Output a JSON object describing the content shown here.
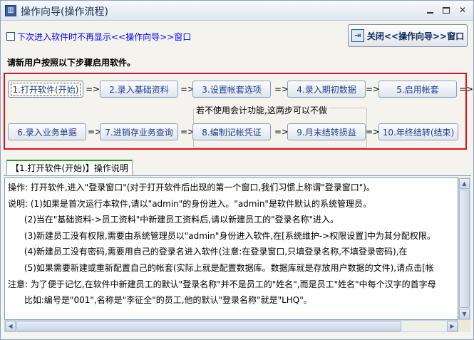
{
  "window": {
    "title": "操作向导(操作流程)"
  },
  "top": {
    "checkbox_label": "下次进入软件时不再显示<<操作向导>>窗口",
    "close_button": "关闭<<操作向导>>窗口"
  },
  "intro": "请新用户按照以下步骤启用软件。",
  "steps": [
    {
      "label": "1.打开软件(开始)"
    },
    {
      "label": "2.录入基础资料"
    },
    {
      "label": "3.设置帐套选项"
    },
    {
      "label": "4.录入期初数据"
    },
    {
      "label": "5.启用帐套"
    },
    {
      "label": "6.录入业务单据"
    },
    {
      "label": "7.进销存业务查询"
    },
    {
      "label": "8.编制记帐凭证"
    },
    {
      "label": "9.月末结转损益"
    },
    {
      "label": "10.年终结转(结束)"
    }
  ],
  "arrow": "=>",
  "group_label": "若不使用会计功能,这两步可以不做",
  "tab_label": "【1.打开软件(开始)】操作说明",
  "description": [
    "操作: 打开软件,进入\"登录窗口\"(对于打开软件后出现的第一个窗口,我们习惯上称谓\"登录窗口\")。",
    "说明: (1)如果是首次运行本软件,请以\"admin\"的身份进入。\"admin\"是软件默认的系统管理员。",
    "      (2)当在\"基础资料->员工资料\"中新建员工资料后,请以新建员工的\"登录名称\"进入。",
    "      (3)新建员工没有权限,需要由系统管理员以\"admin\"身份进入软件,在[系统维护->权限设置]中为其分配权限。",
    "      (4)新建员工没有密码,需要用自己的登录名进入软件(注意:在登录窗口,只填登录名称,不填登录密码),在",
    "      (5)如果需要新建或重新配置自己的帐套(实际上就是配置数据库。数据库就是存放用户数据的文件),请点击[帐",
    "注意: 为了便于记忆,在软件中新建员工的默认\"登录名称\"并不是员工的\"姓名\",而是员工\"姓名\"中每个汉字的首字母",
    "      比如:编号是\"001\",名称是\"李征全\"的员工,他的默认\"登录名称\"就是\"LHQ\"。"
  ]
}
